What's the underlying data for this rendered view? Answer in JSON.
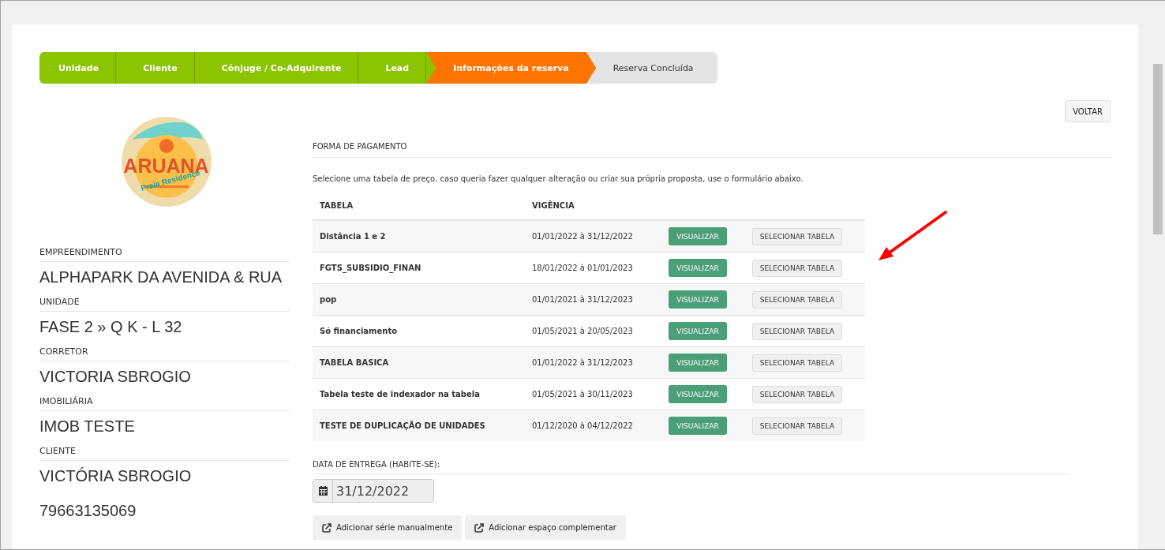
{
  "steps": [
    {
      "label": "Unidade",
      "done": true,
      "selected": false
    },
    {
      "label": "Cliente",
      "done": true,
      "selected": false
    },
    {
      "label": "Cônjuge / Co-Adquirente",
      "done": true,
      "selected": false
    },
    {
      "label": "Lead",
      "done": true,
      "selected": false
    },
    {
      "label": "Informações da reserva",
      "done": false,
      "selected": true
    },
    {
      "label": "Reserva Concluída",
      "done": false,
      "selected": false
    }
  ],
  "back_button": "VOLTAR",
  "logo": {
    "title": "ARUANA",
    "subtitle": "Praia Residence"
  },
  "details": [
    {
      "label": "EMPREENDIMENTO",
      "value": "ALPHAPARK DA AVENIDA & RUA"
    },
    {
      "label": "UNIDADE",
      "value": "FASE 2 » Q K - L 32"
    },
    {
      "label": "CORRETOR",
      "value": "VICTORIA SBROGIO"
    },
    {
      "label": "IMOBILIÁRIA",
      "value": "IMOB TESTE"
    },
    {
      "label": "CLIENTE",
      "value": "VICTÓRIA SBROGIO",
      "extra": "79663135069"
    }
  ],
  "payment": {
    "heading": "FORMA DE PAGAMENTO",
    "instructions": "Selecione uma tabela de preço, caso queria fazer qualquer alteração ou criar sua própria proposta, use o formulário abaixo.",
    "table": {
      "columns": [
        "TABELA",
        "VIGÊNCIA"
      ],
      "rows": [
        {
          "name": "Distância 1 e 2",
          "period": "01/01/2022 à 31/12/2022",
          "view_button": "VISUALIZAR",
          "select_button": "SELECIONAR TABELA"
        },
        {
          "name": "FGTS_SUBSIDIO_FINAN",
          "period": "18/01/2022 à 01/01/2023",
          "view_button": "VISUALIZAR",
          "select_button": "SELECIONAR TABELA"
        },
        {
          "name": "pop",
          "period": "01/01/2021 à 31/12/2023",
          "view_button": "VISUALIZAR",
          "select_button": "SELECIONAR TABELA"
        },
        {
          "name": "Só financiamento",
          "period": "01/05/2021 à 20/05/2023",
          "view_button": "VISUALIZAR",
          "select_button": "SELECIONAR TABELA"
        },
        {
          "name": "TABELA BASICA",
          "period": "01/01/2022 à 31/12/2023",
          "view_button": "VISUALIZAR",
          "select_button": "SELECIONAR TABELA"
        },
        {
          "name": "Tabela teste de indexador na tabela",
          "period": "01/05/2021 à 30/11/2023",
          "view_button": "VISUALIZAR",
          "select_button": "SELECIONAR TABELA"
        },
        {
          "name": "TESTE DE DUPLICAÇÃO DE UNIDADES",
          "period": "01/12/2020 à 04/12/2022",
          "view_button": "VISUALIZAR",
          "select_button": "SELECIONAR TABELA"
        }
      ]
    }
  },
  "delivery": {
    "label": "DATA DE ENTREGA (HABITE-SE):",
    "value": "31/12/2022",
    "disabled": true
  },
  "actions": [
    "Adicionar série manualmente",
    "Adicionar espaço complementar"
  ]
}
